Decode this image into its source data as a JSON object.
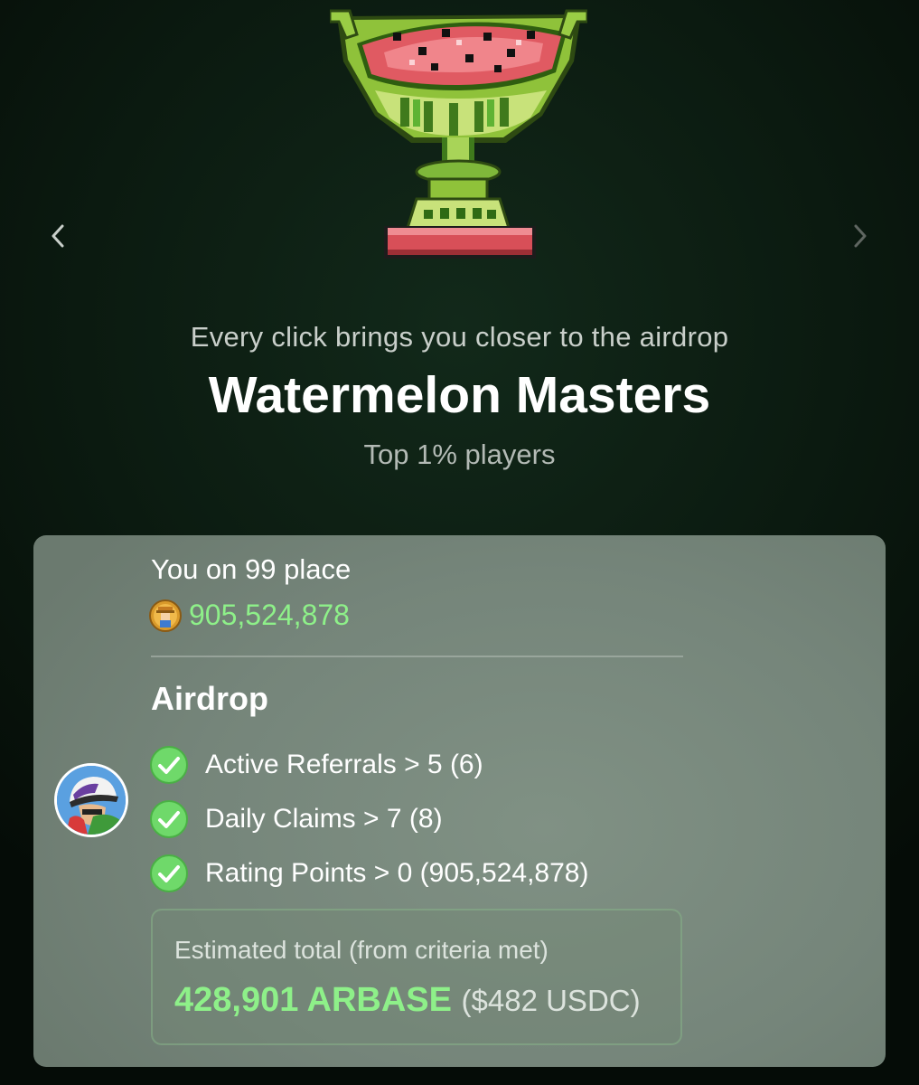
{
  "hero": {
    "image": "watermelon-trophy-icon",
    "subtitle": "Every click brings you closer to the airdrop",
    "title": "Watermelon Masters",
    "tagline": "Top 1% players"
  },
  "navigation": {
    "prev_icon": "chevron-left-icon",
    "next_icon": "chevron-right-icon"
  },
  "user": {
    "avatar": "user-avatar",
    "rank_text": "You on 99 place",
    "coin_icon": "farmer-coin-icon",
    "points": "905,524,878"
  },
  "airdrop": {
    "title": "Airdrop",
    "criteria": [
      {
        "label": "Active Referrals > 5 (6)",
        "met": true
      },
      {
        "label": "Daily Claims > 7 (8)",
        "met": true
      },
      {
        "label": "Rating Points > 0 (905,524,878)",
        "met": true
      }
    ],
    "estimate": {
      "label": "Estimated total (from criteria met)",
      "amount": "428,901 ARBASE",
      "usd": "($482 USDC)"
    }
  },
  "colors": {
    "accent_green": "#8ef089",
    "check_green": "#6fd96a",
    "card_bg": "#7a8a7e",
    "page_bg": "#0b1a10"
  }
}
